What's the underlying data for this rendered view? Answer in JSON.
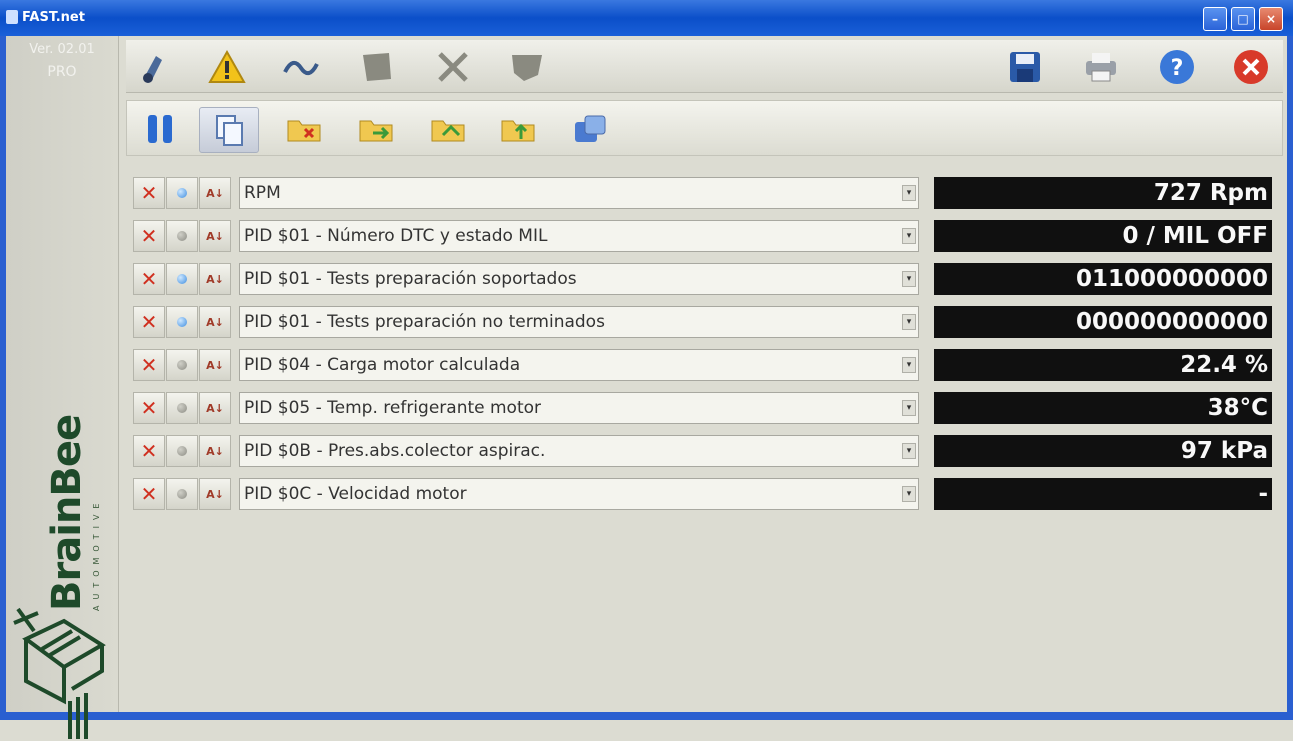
{
  "window": {
    "title": "FAST.net"
  },
  "side": {
    "version": "Ver. 02.01",
    "edition": "PRO",
    "brand": "BrainBee",
    "brand_sub": "AUTOMOTIVE"
  },
  "toolbar1": [
    {
      "name": "vehicle-diag-icon"
    },
    {
      "name": "warning-icon"
    },
    {
      "name": "signal-icon"
    },
    {
      "name": "module-icon"
    },
    {
      "name": "tools-icon"
    },
    {
      "name": "plug-icon"
    }
  ],
  "toolbar1_right": [
    {
      "name": "save-icon"
    },
    {
      "name": "print-icon"
    },
    {
      "name": "help-icon"
    },
    {
      "name": "close-icon"
    }
  ],
  "toolbar2": [
    {
      "name": "pause-icon"
    },
    {
      "name": "copy-icon"
    },
    {
      "name": "folder-remove-icon"
    },
    {
      "name": "folder-forward-icon"
    },
    {
      "name": "folder-open-icon"
    },
    {
      "name": "folder-up-icon"
    },
    {
      "name": "graph-icon"
    }
  ],
  "rows": [
    {
      "label": "RPM",
      "value": "727 Rpm",
      "indicator": "on"
    },
    {
      "label": "PID $01 - Número DTC y estado MIL",
      "value": "0 / MIL OFF",
      "indicator": "off"
    },
    {
      "label": "PID $01 - Tests preparación soportados",
      "value": "011000000000",
      "indicator": "on"
    },
    {
      "label": "PID $01 - Tests preparación no terminados",
      "value": "000000000000",
      "indicator": "on"
    },
    {
      "label": "PID $04 - Carga motor calculada",
      "value": "22.4 %",
      "indicator": "off"
    },
    {
      "label": "PID $05 - Temp. refrigerante motor",
      "value": "38°C",
      "indicator": "off"
    },
    {
      "label": "PID $0B - Pres.abs.colector aspirac.",
      "value": "97 kPa",
      "indicator": "off"
    },
    {
      "label": "PID $0C - Velocidad motor",
      "value": "-",
      "indicator": "off"
    }
  ],
  "colors": {
    "accent": "#0b4fc9",
    "display_bg": "#101010",
    "delete": "#d03020"
  }
}
